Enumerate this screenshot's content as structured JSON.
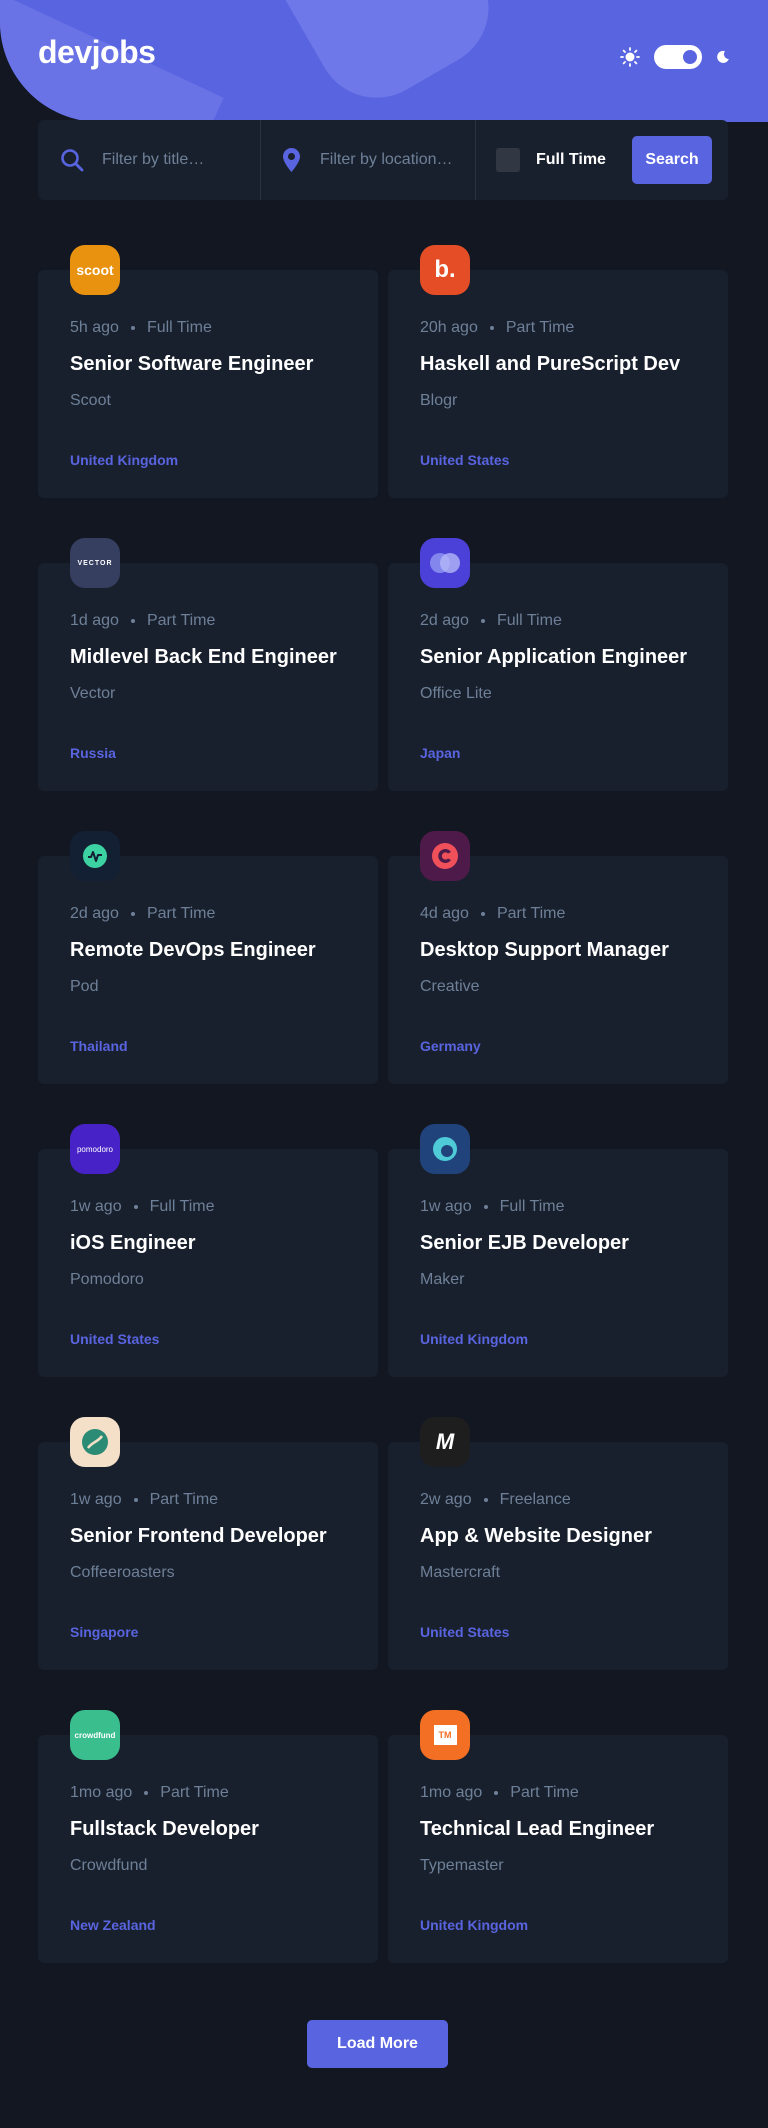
{
  "header": {
    "logo": "devjobs",
    "theme_toggle": {
      "icon_light": "sun-icon",
      "icon_dark": "moon-icon",
      "state": "dark"
    }
  },
  "search": {
    "title_placeholder": "Filter by title…",
    "location_placeholder": "Filter by location…",
    "full_time_label": "Full Time",
    "button_label": "Search"
  },
  "jobs": [
    {
      "posted": "5h ago",
      "contract": "Full Time",
      "position": "Senior Software Engineer",
      "company": "Scoot",
      "location": "United Kingdom",
      "logo_bg": "#e99210",
      "logo_text": "scoot"
    },
    {
      "posted": "20h ago",
      "contract": "Part Time",
      "position": "Haskell and PureScript Dev",
      "company": "Blogr",
      "location": "United States",
      "logo_bg": "#e54d26",
      "logo_text": "b."
    },
    {
      "posted": "1d ago",
      "contract": "Part Time",
      "position": "Midlevel Back End Engineer",
      "company": "Vector",
      "location": "Russia",
      "logo_bg": "#363f5f",
      "logo_text": "VECTOR"
    },
    {
      "posted": "2d ago",
      "contract": "Full Time",
      "position": "Senior Application Engineer",
      "company": "Office Lite",
      "location": "Japan",
      "logo_bg": "#4b41d8",
      "logo_text": ""
    },
    {
      "posted": "2d ago",
      "contract": "Part Time",
      "position": "Remote DevOps Engineer",
      "company": "Pod",
      "location": "Thailand",
      "logo_bg": "#132034",
      "logo_text": ""
    },
    {
      "posted": "4d ago",
      "contract": "Part Time",
      "position": "Desktop Support Manager",
      "company": "Creative",
      "location": "Germany",
      "logo_bg": "#4e1a4a",
      "logo_text": ""
    },
    {
      "posted": "1w ago",
      "contract": "Full Time",
      "position": "iOS Engineer",
      "company": "Pomodoro",
      "location": "United States",
      "logo_bg": "#4722c6",
      "logo_text": "pomodoro"
    },
    {
      "posted": "1w ago",
      "contract": "Full Time",
      "position": "Senior EJB Developer",
      "company": "Maker",
      "location": "United Kingdom",
      "logo_bg": "#21437c",
      "logo_text": ""
    },
    {
      "posted": "1w ago",
      "contract": "Part Time",
      "position": "Senior Frontend Developer",
      "company": "Coffeeroasters",
      "location": "Singapore",
      "logo_bg": "#f4dfc8",
      "logo_text": ""
    },
    {
      "posted": "2w ago",
      "contract": "Freelance",
      "position": "App & Website Designer",
      "company": "Mastercraft",
      "location": "United States",
      "logo_bg": "#1e1e1e",
      "logo_text": "M"
    },
    {
      "posted": "1mo ago",
      "contract": "Part Time",
      "position": "Fullstack Developer",
      "company": "Crowdfund",
      "location": "New Zealand",
      "logo_bg": "#3bbe8e",
      "logo_text": "crowdfund"
    },
    {
      "posted": "1mo ago",
      "contract": "Part Time",
      "position": "Technical Lead Engineer",
      "company": "Typemaster",
      "location": "United Kingdom",
      "logo_bg": "#f26f24",
      "logo_text": "TM"
    }
  ],
  "load_more_label": "Load More",
  "colors": {
    "accent": "#5964e0",
    "bg": "#121721",
    "card": "#19202d",
    "muted": "#6e8098"
  }
}
